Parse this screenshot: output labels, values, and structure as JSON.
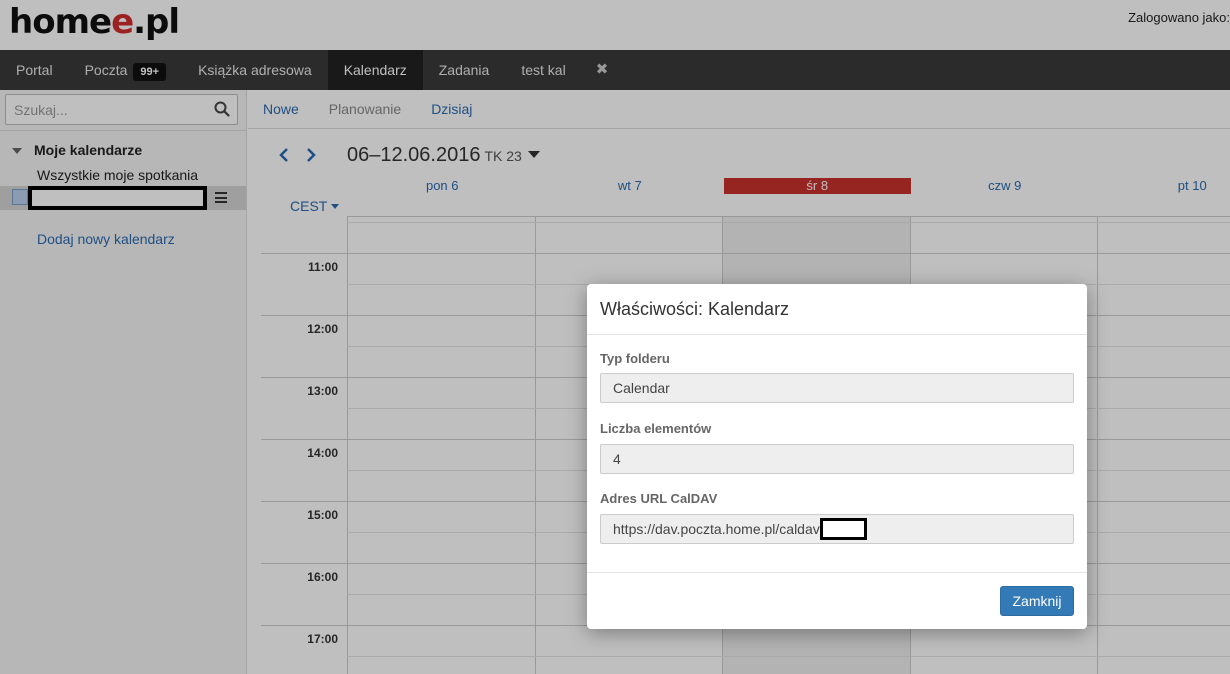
{
  "header": {
    "logo_main": "home",
    "logo_accent": "e",
    "logo_suffix": ".pl",
    "login_text": "Zalogowano jako:"
  },
  "nav": {
    "items": [
      {
        "label": "Portal"
      },
      {
        "label": "Poczta",
        "badge": "99+"
      },
      {
        "label": "Książka adresowa"
      },
      {
        "label": "Kalendarz",
        "active": true
      },
      {
        "label": "Zadania"
      },
      {
        "label": "test kal"
      }
    ],
    "close_glyph": "✖"
  },
  "sidebar": {
    "search_placeholder": "Szukaj...",
    "group_label": "Moje kalendarze",
    "all_meetings": "Wszystkie moje spotkania",
    "add_calendar": "Dodaj nowy kalendarz"
  },
  "toolbar": {
    "new": "Nowe",
    "planning": "Planowanie",
    "today": "Dzisiaj"
  },
  "calendar": {
    "week_range": "06–12.06.2016",
    "week_number": "TK 23",
    "timezone": "CEST",
    "days": [
      "pon 6",
      "wt 7",
      "śr 8",
      "czw 9",
      "pt 10"
    ],
    "today_index": 2,
    "hours": [
      "11:00",
      "12:00",
      "13:00",
      "14:00",
      "15:00",
      "16:00",
      "17:00"
    ]
  },
  "modal": {
    "title": "Właściwości: Kalendarz",
    "folder_type_label": "Typ folderu",
    "folder_type_value": "Calendar",
    "item_count_label": "Liczba elementów",
    "item_count_value": "4",
    "caldav_label": "Adres URL CalDAV",
    "caldav_value": "https://dav.poczta.home.pl/caldav",
    "close_button": "Zamknij"
  },
  "colors": {
    "accent": "#337ab7",
    "link": "#2a6ab0",
    "today": "#c9302c",
    "nav_bg": "#3a3a3a"
  }
}
